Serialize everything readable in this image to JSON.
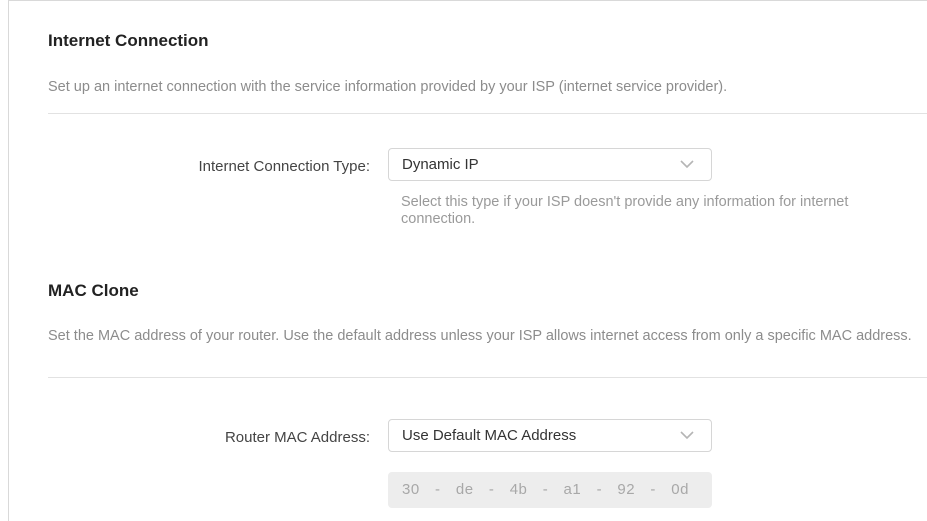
{
  "internet_connection": {
    "title": "Internet Connection",
    "description": "Set up an internet connection with the service information provided by your ISP (internet service provider).",
    "type_label": "Internet Connection Type:",
    "type_value": "Dynamic IP",
    "type_hint": "Select this type if your ISP doesn't provide any information for internet connection."
  },
  "mac_clone": {
    "title": "MAC Clone",
    "description": "Set the MAC address of your router. Use the default address unless your ISP allows internet access from only a specific MAC address.",
    "mac_label": "Router MAC Address:",
    "mac_option": "Use Default MAC Address",
    "mac_address": "30  -  de  -  4b  -  a1  -  92  -  0d"
  },
  "icons": {
    "dropdown": "chevron-down-icon"
  },
  "colors": {
    "title": "#222222",
    "description": "#8c8c8c",
    "hint": "#9a9a9a",
    "disabled_bg": "#ededed"
  }
}
